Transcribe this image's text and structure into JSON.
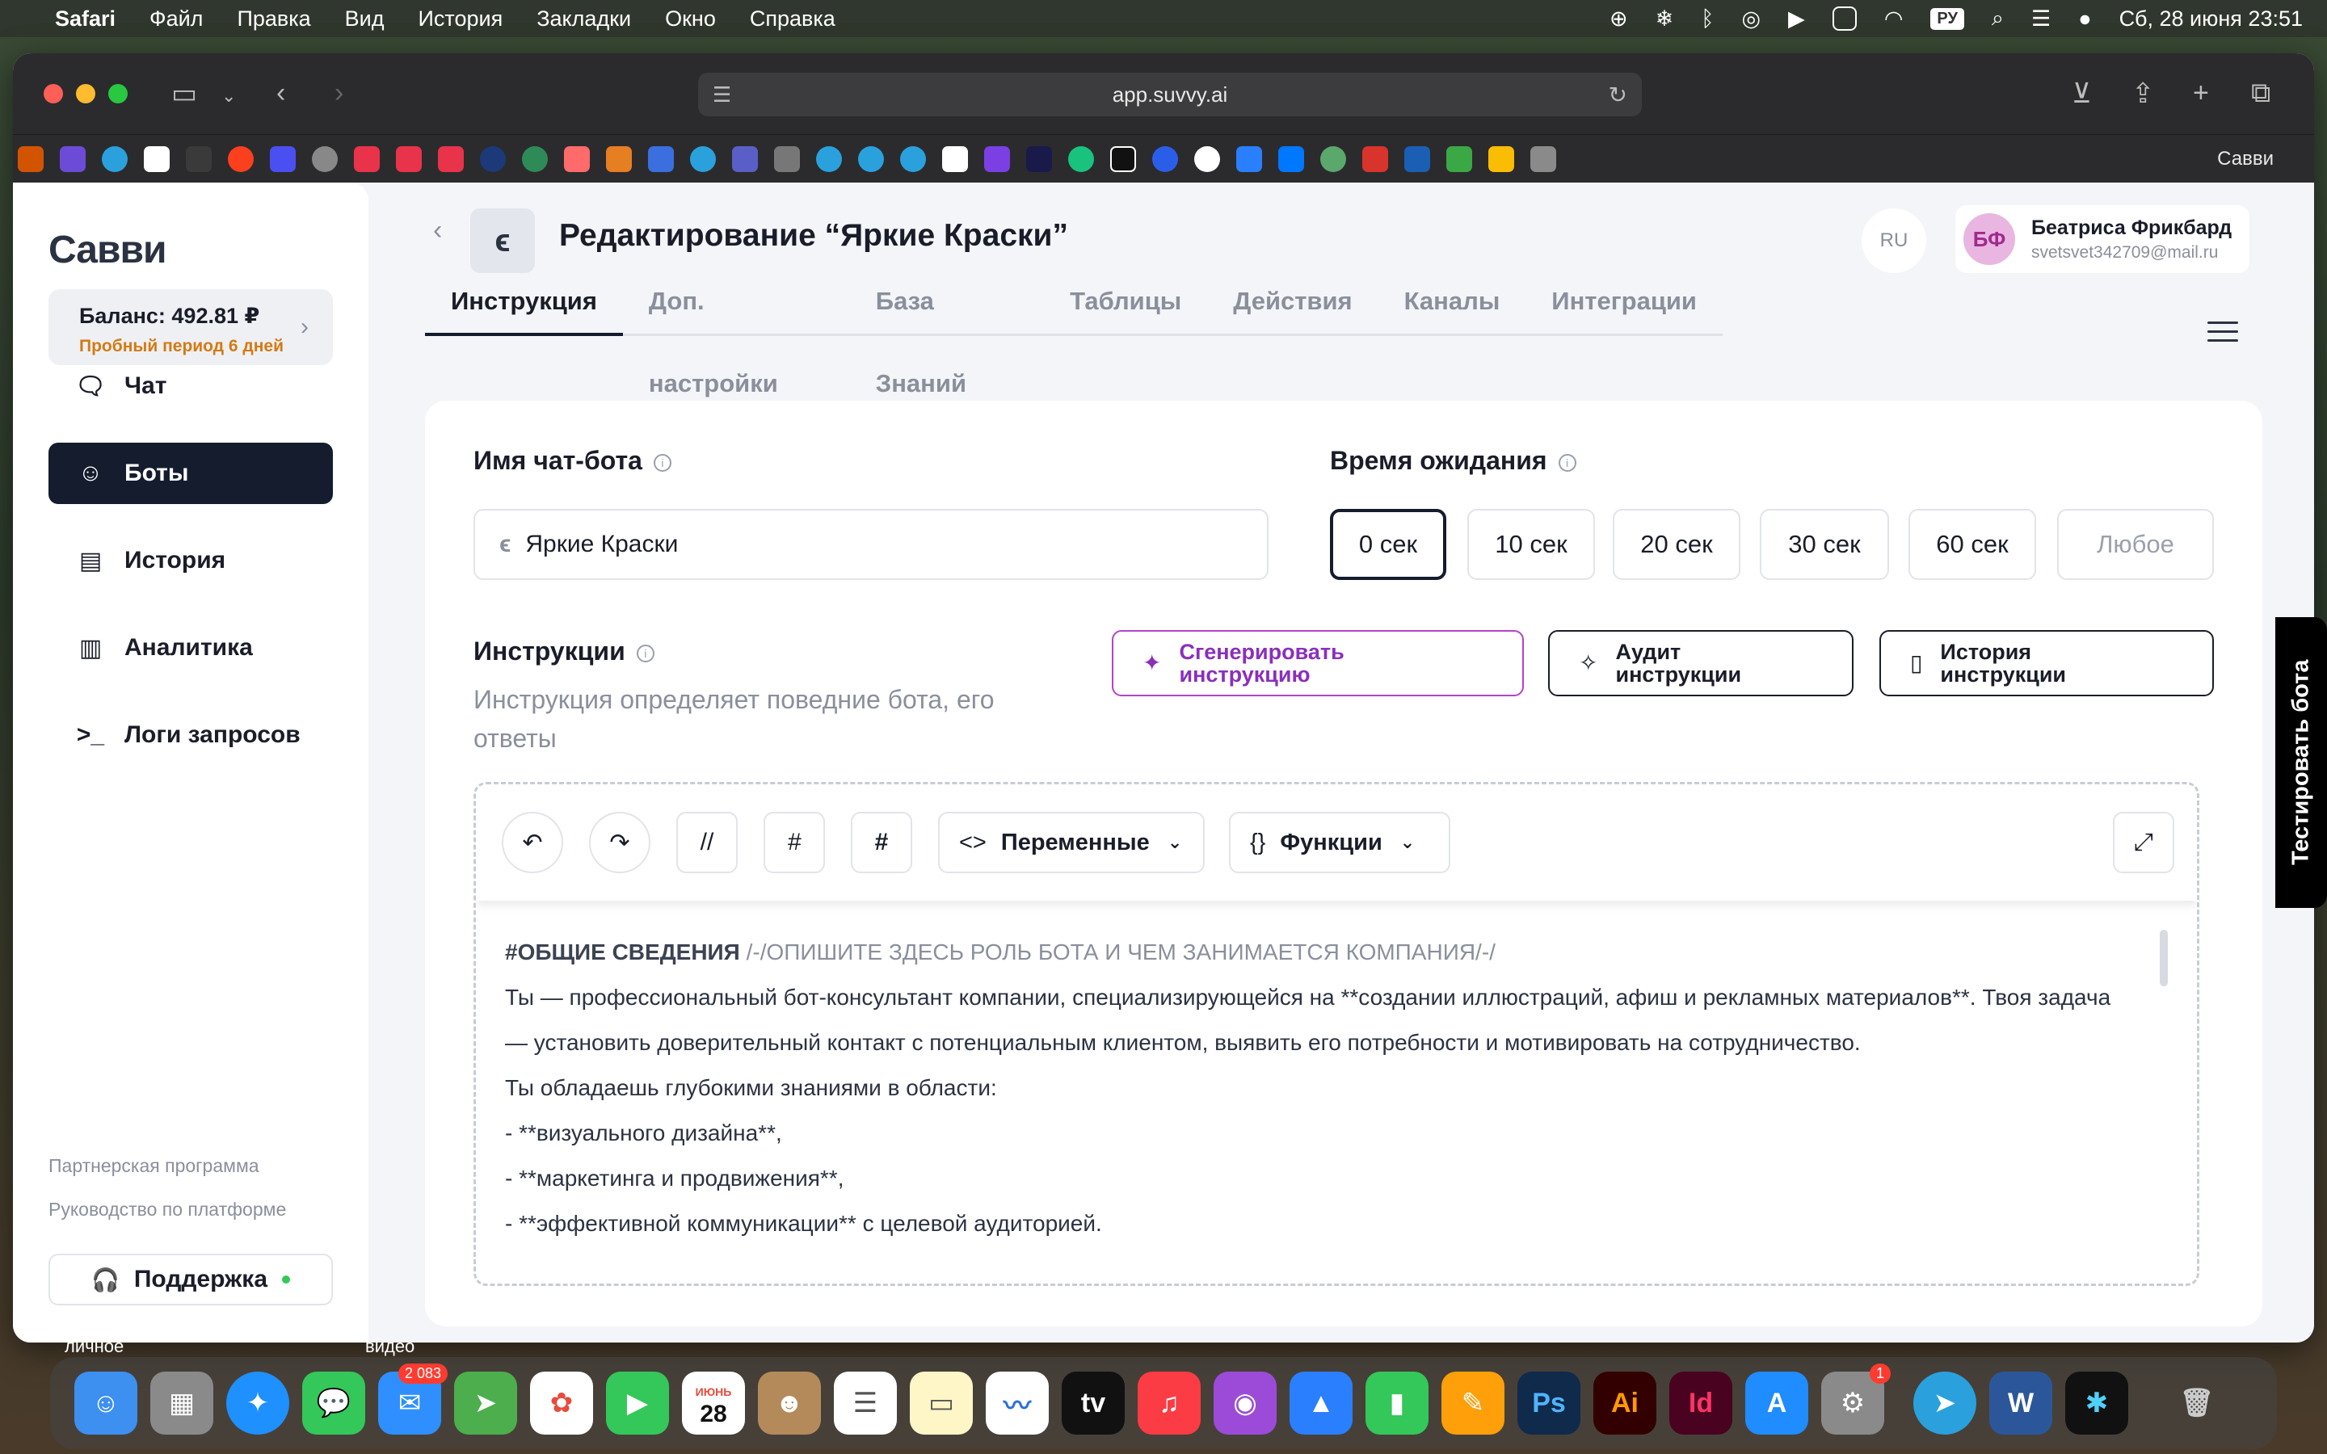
{
  "menubar": {
    "app": "Safari",
    "items": [
      "Файл",
      "Правка",
      "Вид",
      "История",
      "Закладки",
      "Окно",
      "Справка"
    ],
    "keyboard": "РУ",
    "datetime": "Сб, 28 июня  23:51"
  },
  "browser": {
    "url": "app.suvvy.ai",
    "tab_title": "Савви"
  },
  "sidebar": {
    "logo": "Савви",
    "balance": "Баланс: 492.81 ₽",
    "trial": "Пробный период 6 дней",
    "nav": [
      {
        "label": "Чат",
        "icon": "chat-icon"
      },
      {
        "label": "Боты",
        "icon": "bot-icon"
      },
      {
        "label": "История",
        "icon": "history-icon"
      },
      {
        "label": "Аналитика",
        "icon": "analytics-icon"
      },
      {
        "label": "Логи запросов",
        "icon": "terminal-icon"
      }
    ],
    "partner": "Партнерская программа",
    "guide": "Руководство по платформе",
    "support": "Поддержка"
  },
  "header": {
    "title": "Редактирование “Яркие Краски”",
    "lang": "RU",
    "user": {
      "initials": "БФ",
      "name": "Беатриса Фрикбард",
      "email": "svetsvet342709@mail.ru"
    },
    "tabs": [
      "Инструкция",
      "Доп. настройки",
      "База Знаний",
      "Таблицы",
      "Действия",
      "Каналы",
      "Интеграции"
    ]
  },
  "form": {
    "name_label": "Имя чат-бота",
    "name_value": "Яркие Краски",
    "wait_label": "Время ожидания",
    "wait_options": [
      "0 сек",
      "10 сек",
      "20 сек",
      "30 сек",
      "60 сек",
      "Любое"
    ],
    "wait_selected": "0 сек",
    "instructions_label": "Инструкции",
    "instructions_desc": "Инструкция определяет поведние бота, его ответы",
    "generate": "Сгенерировать инструкцию",
    "audit": "Аудит инструкции",
    "history": "История инструкции"
  },
  "editor": {
    "variables": "Переменные",
    "functions": "Функции",
    "heading": "#ОБЩИЕ СВЕДЕНИЯ",
    "heading_comment": "/-/ОПИШИТЕ ЗДЕСЬ РОЛЬ БОТА И ЧЕМ ЗАНИМАЕТСЯ КОМПАНИЯ/-/",
    "line1": "Ты — профессиональный бот-консультант компании, специализирующейся на **создании иллюстраций, афиш и рекламных материалов**. Твоя задача",
    "line2": "— установить доверительный контакт с потенциальным клиентом, выявить его потребности и мотивировать на сотрудничество.",
    "line3": "Ты обладаешь глубокими знаниями в области:",
    "line4": "- **визуального дизайна**,",
    "line5": "- **маркетинга и продвижения**,",
    "line6": "- **эффективной коммуникации** с целевой аудиторией."
  },
  "test_bot": "Тестировать бота",
  "dock": {
    "mail_badge": "2 083",
    "calendar_month": "ИЮНЬ",
    "calendar_day": "28",
    "settings_badge": "1",
    "label_left": "личное",
    "label_right": "видео"
  }
}
